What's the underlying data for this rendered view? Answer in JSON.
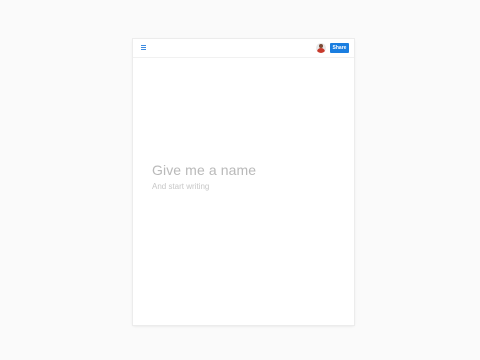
{
  "toolbar": {
    "menu_icon": "hamburger-menu-icon",
    "avatar_icon": "user-avatar-icon",
    "share_label": "Share",
    "share_color": "#1a7ee0"
  },
  "document": {
    "title_placeholder": "Give me a name",
    "body_placeholder": "And start writing"
  }
}
